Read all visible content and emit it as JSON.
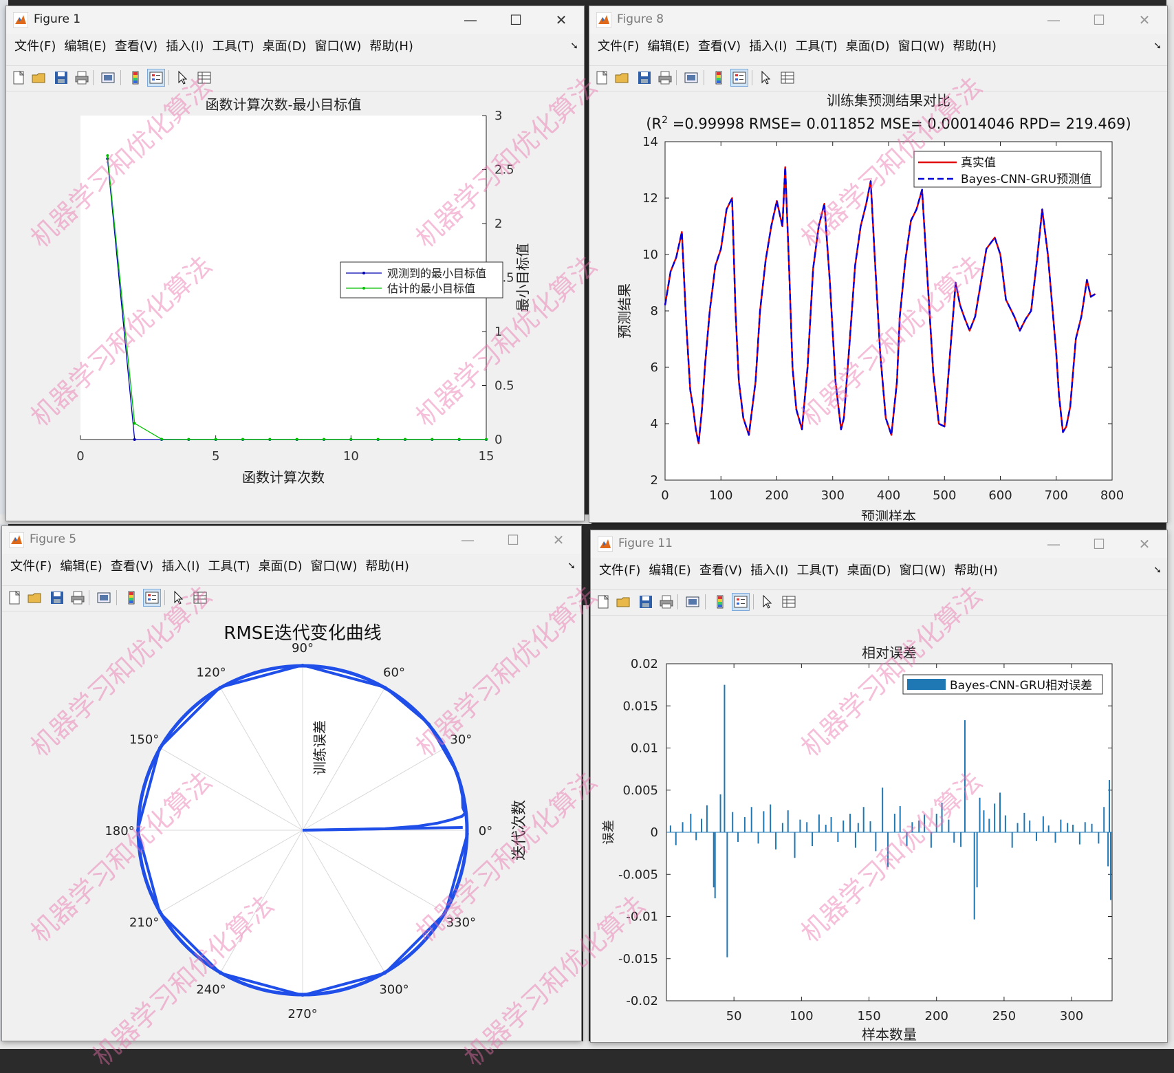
{
  "menu": [
    "文件(F)",
    "编辑(E)",
    "查看(V)",
    "插入(I)",
    "工具(T)",
    "桌面(D)",
    "窗口(W)",
    "帮助(H)"
  ],
  "watermark": "机器学习和优化算法",
  "icons": [
    "new-file-icon",
    "open-folder-icon",
    "save-icon",
    "print-icon",
    "print-preview-icon",
    "colorbar-icon",
    "legend-icon",
    "pointer-icon",
    "property-inspector-icon"
  ],
  "figure1": {
    "title": "Figure 1",
    "chart_data": {
      "type": "line",
      "title": "函数计算次数-最小目标值",
      "xlabel": "函数计算次数",
      "ylabel": "最小目标值",
      "xlim": [
        0,
        15
      ],
      "ylim": [
        0,
        3
      ],
      "xticks": [
        "0",
        "5",
        "10",
        "15"
      ],
      "yticks": [
        "0",
        "0.5",
        "1",
        "1.5",
        "2",
        "2.5",
        "3"
      ],
      "legend_position": "center-right",
      "series": [
        {
          "name": "观测到的最小目标值",
          "color": "#0000b0",
          "x": [
            1,
            2,
            3,
            4,
            5,
            6,
            7,
            8,
            9,
            10,
            11,
            12,
            13,
            14,
            15
          ],
          "y": [
            2.6,
            0.0002,
            0.0002,
            0.0002,
            0.0002,
            0.0002,
            0.0002,
            0.0002,
            0.0002,
            0.0002,
            0.0002,
            0.0002,
            0.0002,
            0.0002,
            0.0002
          ]
        },
        {
          "name": "估计的最小目标值",
          "color": "#00c000",
          "x": [
            1,
            2,
            3,
            4,
            5,
            6,
            7,
            8,
            9,
            10,
            11,
            12,
            13,
            14,
            15
          ],
          "y": [
            2.63,
            0.15,
            0.003,
            0.002,
            0.002,
            0.002,
            0.002,
            0.002,
            0.002,
            0.002,
            0.002,
            0.002,
            0.002,
            0.002,
            0.002
          ]
        }
      ]
    }
  },
  "figure8": {
    "title": "Figure 8",
    "chart_data": {
      "type": "line",
      "title": "训练集预测结果对比",
      "subtitle_prefix": "(R",
      "subtitle_sup": "2",
      "subtitle_rest": " =0.99998 RMSE= 0.011852 MSE= 0.00014046 RPD= 219.469)",
      "xlabel": "预测样本",
      "ylabel": "预测结果",
      "xlim": [
        0,
        800
      ],
      "ylim": [
        2,
        14
      ],
      "xticks": [
        "0",
        "100",
        "200",
        "300",
        "400",
        "500",
        "600",
        "700",
        "800"
      ],
      "yticks": [
        "2",
        "4",
        "6",
        "8",
        "10",
        "12",
        "14"
      ],
      "legend_position": "top-right",
      "series": [
        {
          "name": "真实值",
          "color": "#e00000",
          "style": "solid",
          "x": [
            0,
            10,
            20,
            30,
            38,
            45,
            50,
            55,
            60,
            66,
            72,
            80,
            90,
            100,
            110,
            120,
            126,
            132,
            140,
            150,
            162,
            170,
            180,
            190,
            200,
            210,
            215,
            222,
            228,
            235,
            245,
            255,
            265,
            275,
            285,
            295,
            305,
            315,
            320,
            330,
            340,
            350,
            360,
            368,
            375,
            385,
            395,
            405,
            415,
            420,
            430,
            440,
            450,
            460,
            470,
            480,
            490,
            500,
            510,
            516,
            520,
            528,
            535,
            545,
            555,
            565,
            575,
            590,
            600,
            610,
            625,
            635,
            645,
            655,
            665,
            675,
            685,
            700,
            705,
            712,
            718,
            725,
            735,
            745,
            755,
            762,
            770
          ],
          "y": [
            8.2,
            9.4,
            9.9,
            10.8,
            7.5,
            5.2,
            4.6,
            3.8,
            3.3,
            4.5,
            6.2,
            8.0,
            9.6,
            10.2,
            11.6,
            12.0,
            8.0,
            5.5,
            4.2,
            3.6,
            5.5,
            8.0,
            9.8,
            11.0,
            11.9,
            11.0,
            13.1,
            9.5,
            6.0,
            4.5,
            3.8,
            6.0,
            9.5,
            11.0,
            11.8,
            9.0,
            5.5,
            3.8,
            4.2,
            6.8,
            9.6,
            11.0,
            11.8,
            12.6,
            10.0,
            6.5,
            4.2,
            3.6,
            5.5,
            7.8,
            9.8,
            11.2,
            11.6,
            12.3,
            9.0,
            5.8,
            4.0,
            3.9,
            6.5,
            8.0,
            9.0,
            8.2,
            7.8,
            7.3,
            7.8,
            9.0,
            10.2,
            10.6,
            10.0,
            8.4,
            7.8,
            7.3,
            7.7,
            8.0,
            9.7,
            11.6,
            10.0,
            6.5,
            5.0,
            3.7,
            3.9,
            4.6,
            7.0,
            7.8,
            9.1,
            8.5,
            8.6
          ]
        },
        {
          "name": "Bayes-CNN-GRU预测值",
          "color": "#0000e0",
          "style": "dashed",
          "x": [
            0,
            10,
            20,
            30,
            38,
            45,
            50,
            55,
            60,
            66,
            72,
            80,
            90,
            100,
            110,
            120,
            126,
            132,
            140,
            150,
            162,
            170,
            180,
            190,
            200,
            210,
            215,
            222,
            228,
            235,
            245,
            255,
            265,
            275,
            285,
            295,
            305,
            315,
            320,
            330,
            340,
            350,
            360,
            368,
            375,
            385,
            395,
            405,
            415,
            420,
            430,
            440,
            450,
            460,
            470,
            480,
            490,
            500,
            510,
            516,
            520,
            528,
            535,
            545,
            555,
            565,
            575,
            590,
            600,
            610,
            625,
            635,
            645,
            655,
            665,
            675,
            685,
            700,
            705,
            712,
            718,
            725,
            735,
            745,
            755,
            762,
            770
          ],
          "y": [
            8.2,
            9.4,
            9.9,
            10.8,
            7.5,
            5.2,
            4.6,
            3.8,
            3.3,
            4.5,
            6.2,
            8.0,
            9.6,
            10.2,
            11.6,
            12.0,
            8.0,
            5.5,
            4.2,
            3.6,
            5.5,
            8.0,
            9.8,
            11.0,
            11.9,
            11.0,
            13.1,
            9.5,
            6.0,
            4.5,
            3.8,
            6.0,
            9.5,
            11.0,
            11.8,
            9.0,
            5.5,
            3.8,
            4.2,
            6.8,
            9.6,
            11.0,
            11.8,
            12.6,
            10.0,
            6.5,
            4.2,
            3.6,
            5.5,
            7.8,
            9.8,
            11.2,
            11.6,
            12.3,
            9.0,
            5.8,
            4.0,
            3.9,
            6.5,
            8.0,
            9.0,
            8.2,
            7.8,
            7.3,
            7.8,
            9.0,
            10.2,
            10.6,
            10.0,
            8.4,
            7.8,
            7.3,
            7.7,
            8.0,
            9.7,
            11.6,
            10.0,
            6.5,
            5.0,
            3.7,
            3.9,
            4.6,
            7.0,
            7.8,
            9.1,
            8.5,
            8.6
          ]
        }
      ]
    }
  },
  "figure5": {
    "title": "Figure 5",
    "chart_data": {
      "type": "polar",
      "title": "RMSE迭代变化曲线",
      "rlabel": "训练误差",
      "thetalabel": "迭代次数",
      "angle_labels": [
        "0°",
        "30°",
        "60°",
        "90°",
        "120°",
        "150°",
        "180°",
        "210°",
        "240°",
        "270°",
        "300°",
        "330°"
      ],
      "rlim": [
        0,
        1
      ],
      "series": [
        {
          "name": "",
          "color": "#1f4fe8",
          "theta_deg": [
            0,
            1,
            2,
            3,
            4,
            5,
            6,
            8,
            12,
            20,
            40,
            60,
            90,
            120,
            150,
            180,
            210,
            240,
            270,
            300,
            330,
            359
          ],
          "r": [
            0.0,
            0.5,
            0.7,
            0.82,
            0.9,
            0.97,
            0.99,
            0.98,
            0.99,
            1.0,
            1.0,
            1.0,
            1.0,
            1.0,
            1.0,
            1.0,
            1.0,
            1.0,
            1.0,
            1.0,
            1.0,
            1.0
          ]
        }
      ]
    }
  },
  "figure11": {
    "title": "Figure 11",
    "chart_data": {
      "type": "bar",
      "title": "相对误差",
      "xlabel": "样本数量",
      "ylabel": "误差",
      "xlim": [
        0,
        330
      ],
      "ylim": [
        -0.02,
        0.02
      ],
      "xticks": [
        "50",
        "100",
        "150",
        "200",
        "250",
        "300"
      ],
      "yticks": [
        "-0.02",
        "-0.015",
        "-0.01",
        "-0.005",
        "0",
        "0.005",
        "0.01",
        "0.015",
        "0.02"
      ],
      "legend_position": "top-right",
      "series": [
        {
          "name": "Bayes-CNN-GRU相对误差",
          "color": "#1f77b4",
          "x": [
            3,
            7,
            12,
            18,
            22,
            26,
            30,
            35,
            36,
            40,
            43,
            45,
            49,
            53,
            58,
            63,
            68,
            72,
            77,
            81,
            86,
            90,
            95,
            99,
            104,
            108,
            113,
            118,
            122,
            127,
            131,
            136,
            140,
            142,
            146,
            151,
            155,
            160,
            164,
            169,
            173,
            178,
            182,
            187,
            191,
            196,
            200,
            204,
            209,
            213,
            218,
            221,
            228,
            230,
            232,
            235,
            239,
            243,
            247,
            251,
            256,
            260,
            265,
            269,
            274,
            279,
            283,
            288,
            292,
            297,
            301,
            306,
            310,
            315,
            320,
            324,
            327,
            328,
            329
          ],
          "y": [
            0.0008,
            -0.0015,
            0.0012,
            0.0022,
            -0.0009,
            0.0016,
            0.0032,
            -0.0065,
            -0.0078,
            0.0045,
            0.0175,
            -0.0148,
            0.0024,
            -0.0011,
            0.0018,
            0.003,
            -0.0013,
            0.0025,
            0.0033,
            -0.002,
            0.0011,
            0.0026,
            -0.003,
            0.0015,
            0.0012,
            -0.0016,
            0.0021,
            0.0009,
            0.0018,
            -0.0011,
            0.0014,
            0.0022,
            -0.0018,
            0.0011,
            0.003,
            0.0013,
            -0.0022,
            0.0053,
            -0.0041,
            0.0022,
            0.0031,
            -0.0016,
            0.0012,
            0.0014,
            0.0021,
            -0.0018,
            0.0022,
            0.0035,
            0.0015,
            -0.0012,
            -0.0017,
            0.0133,
            -0.0103,
            -0.0065,
            0.0041,
            0.0026,
            0.0016,
            0.0034,
            0.0047,
            0.002,
            -0.0018,
            0.0011,
            0.0023,
            0.0014,
            -0.001,
            0.0019,
            0.0008,
            -0.0012,
            0.0015,
            0.0011,
            0.0009,
            -0.0014,
            0.0012,
            0.001,
            -0.0013,
            0.003,
            -0.004,
            0.0062,
            -0.008
          ]
        }
      ]
    }
  }
}
